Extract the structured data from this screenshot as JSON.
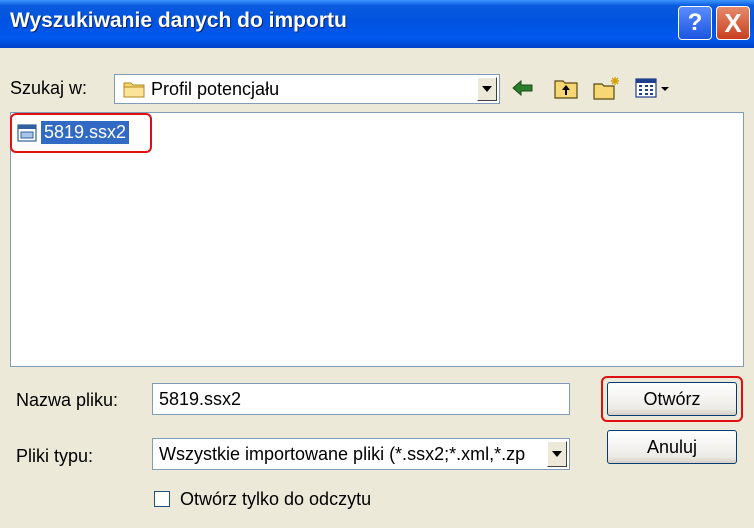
{
  "window": {
    "title": "Wyszukiwanie danych do importu",
    "help_label": "?",
    "close_label": "X"
  },
  "lookin": {
    "label": "Szukaj w:",
    "value": "Profil potencjału"
  },
  "toolbar": {
    "back_icon": "back-arrow-icon",
    "up_icon": "up-folder-icon",
    "newfolder_icon": "new-folder-icon",
    "views_icon": "views-menu-icon"
  },
  "files": [
    {
      "name": "5819.ssx2",
      "selected": true
    }
  ],
  "filename": {
    "label": "Nazwa pliku:",
    "value": "5819.ssx2"
  },
  "filetype": {
    "label": "Pliki typu:",
    "value": "Wszystkie importowane pliki (*.ssx2;*.xml,*.zp"
  },
  "buttons": {
    "open": "Otwórz",
    "cancel": "Anuluj"
  },
  "readonly": {
    "label": "Otwórz tylko do odczytu",
    "checked": false
  },
  "colors": {
    "titlebar": "#0053e0",
    "highlight": "#316ac5",
    "annotation_red": "#e01010"
  }
}
